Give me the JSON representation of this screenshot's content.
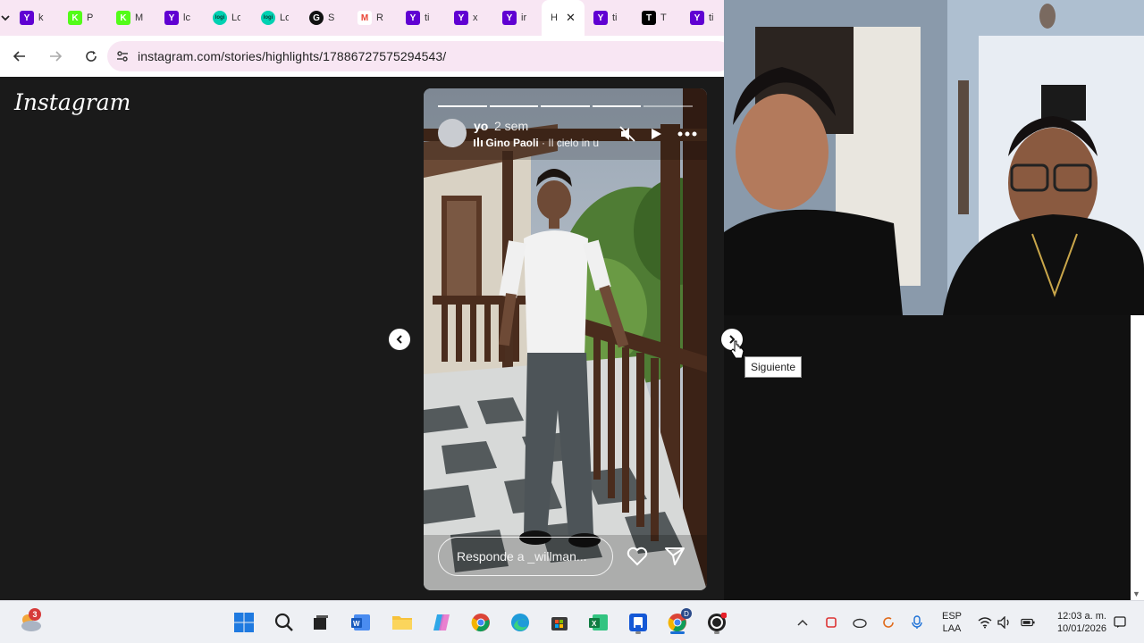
{
  "browser": {
    "tabs": [
      {
        "letter": "Y",
        "title": "k",
        "color": "#6001d2"
      },
      {
        "letter": "K",
        "title": "P",
        "color": "#53fc18"
      },
      {
        "letter": "K",
        "title": "M",
        "color": "#53fc18"
      },
      {
        "letter": "Y",
        "title": "lc",
        "color": "#6001d2"
      },
      {
        "letter": "logi",
        "title": "Lo",
        "color": "#00d1b2"
      },
      {
        "letter": "logi",
        "title": "Lo",
        "color": "#00d1b2"
      },
      {
        "letter": "G",
        "title": "S",
        "color": "#111111"
      },
      {
        "letter": "M",
        "title": "R",
        "color": "#ea4335"
      },
      {
        "letter": "Y",
        "title": "ti",
        "color": "#6001d2"
      },
      {
        "letter": "Y",
        "title": "x",
        "color": "#6001d2"
      },
      {
        "letter": "Y",
        "title": "ir",
        "color": "#6001d2"
      },
      {
        "letter": "",
        "title": "H",
        "color": "#ffffff",
        "active": true
      },
      {
        "letter": "Y",
        "title": "ti",
        "color": "#6001d2"
      },
      {
        "letter": "T",
        "title": "T",
        "color": "#000000"
      },
      {
        "letter": "Y",
        "title": "ti",
        "color": "#6001d2"
      }
    ],
    "url": "instagram.com/stories/highlights/17886727575294543/"
  },
  "instagram": {
    "logo": "Instagram",
    "story": {
      "username": "yo",
      "time": "2 sem",
      "song_artist": "Gino Paoli",
      "song_title": "· Il cielo in u",
      "reply_placeholder": "Responde a _willman...",
      "progress_total": 5,
      "progress_done": 4
    },
    "tooltip": "Siguiente"
  },
  "taskbar": {
    "weather_badge": "3",
    "language": "ESP",
    "language_sub": "LAA",
    "time": "12:03 a. m.",
    "date": "10/01/2026",
    "profile_badge": "D"
  },
  "colors": {
    "tab_strip": "#f8e6f3",
    "instagram_bg": "#1a1a1a",
    "taskbar": "#eef0f4"
  }
}
